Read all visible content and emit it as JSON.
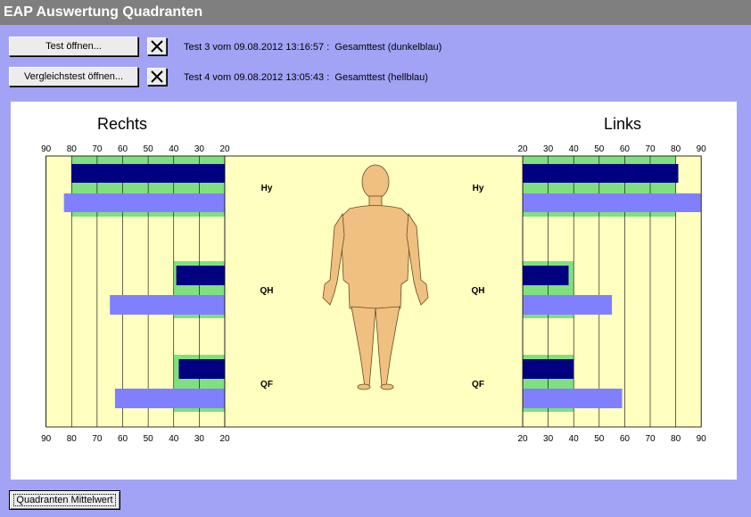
{
  "window": {
    "title": "EAP Auswertung Quadranten"
  },
  "controls": {
    "open_test_label": "Test öffnen...",
    "open_compare_label": "Vergleichstest öffnen...",
    "test_info": "Test 3 vom 09.08.2012 13:16:57 :  Gesamttest (dunkelblau)",
    "compare_info": "Test 4 vom 09.08.2012 13:05:43 :  Gesamttest (hellblau)",
    "mean_button_label": "Quadranten Mittelwert"
  },
  "chart_data": {
    "type": "bar",
    "titles": {
      "left": "Rechts",
      "right": "Links"
    },
    "axis_ticks": [
      90,
      80,
      70,
      60,
      50,
      40,
      30,
      20
    ],
    "axis_ticks_right": [
      20,
      30,
      40,
      50,
      60,
      70,
      80,
      90
    ],
    "muscles": [
      "Hy",
      "QH",
      "QF"
    ],
    "series": [
      {
        "name": "Gesamttest (dunkelblau)",
        "color": "#000080",
        "rechts": {
          "Hy": 80,
          "QH": 39,
          "QF": 38
        },
        "links": {
          "Hy": 81,
          "QH": 38,
          "QF": 40
        }
      },
      {
        "name": "Gesamttest (hellblau)",
        "color": "#8080ff",
        "rechts": {
          "Hy": 83,
          "QH": 65,
          "QF": 63
        },
        "links": {
          "Hy": 90,
          "QH": 55,
          "QF": 59
        }
      }
    ],
    "norm_ranges": {
      "rechts": {
        "Hy": [
          20,
          80
        ],
        "QH": [
          20,
          40
        ],
        "QF": [
          20,
          40
        ]
      },
      "links": {
        "Hy": [
          20,
          80
        ],
        "QH": [
          20,
          40
        ],
        "QF": [
          20,
          40
        ]
      }
    },
    "colors": {
      "background": "#ffffc0",
      "norm": "#80e080",
      "body": "#f0c080"
    }
  }
}
